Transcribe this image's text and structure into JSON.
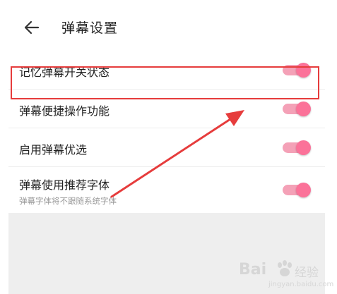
{
  "header": {
    "title": "弹幕设置",
    "back_icon": "arrow-left-icon"
  },
  "settings": [
    {
      "label": "记忆弹幕开关状态",
      "sublabel": "",
      "toggle_on": true
    },
    {
      "label": "弹幕便捷操作功能",
      "sublabel": "",
      "toggle_on": true
    },
    {
      "label": "启用弹幕优选",
      "sublabel": "",
      "toggle_on": true
    },
    {
      "label": "弹幕使用推荐字体",
      "sublabel": "弹幕字体将不跟随系统字体",
      "toggle_on": true
    }
  ],
  "colors": {
    "toggle_thumb": "#fb7299",
    "toggle_track": "#f4a1b7",
    "annotation": "#e63c3c"
  },
  "watermark": {
    "logo": "Bai",
    "text": "经验",
    "url": "jingyan.baidu.com"
  }
}
